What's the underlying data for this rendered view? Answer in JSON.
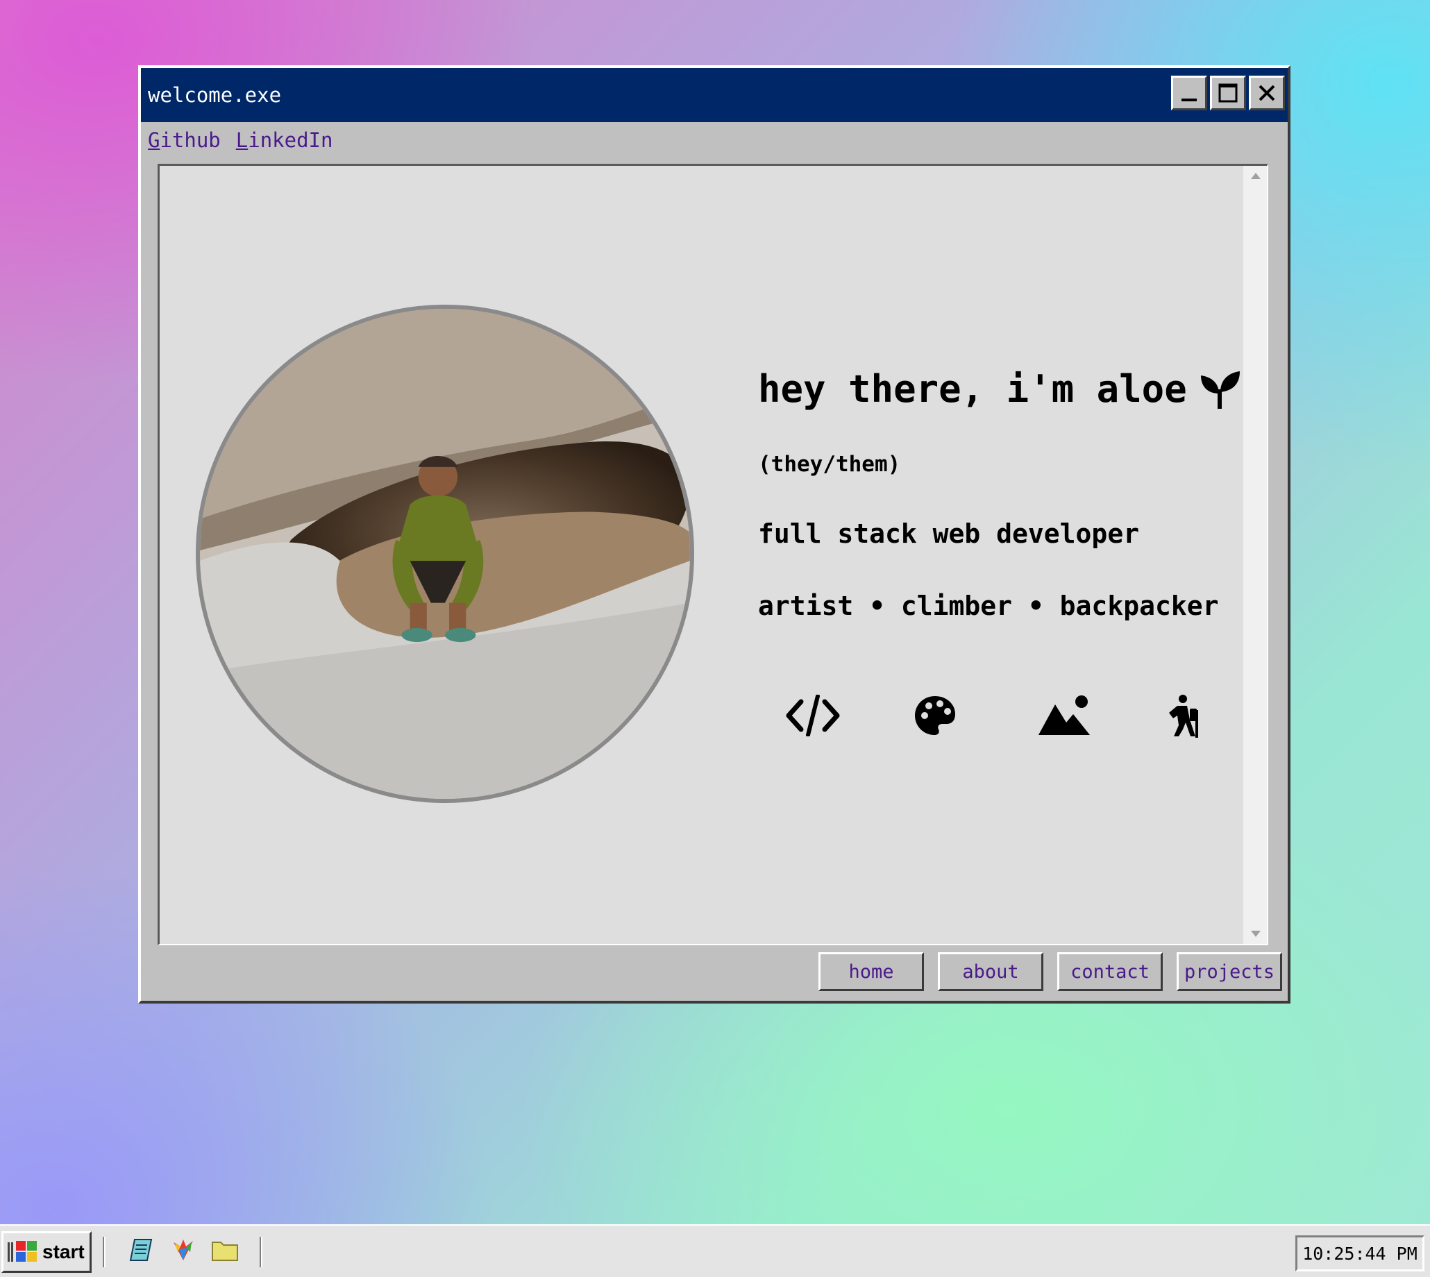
{
  "window": {
    "title": "welcome.exe",
    "controls": {
      "minimize": "minimize-icon",
      "maximize": "maximize-icon",
      "close": "close-icon"
    }
  },
  "menu": {
    "links": [
      {
        "accel": "G",
        "rest": "ithub"
      },
      {
        "accel": "L",
        "rest": "inkedIn"
      }
    ]
  },
  "intro": {
    "title": "hey there, i'm aloe",
    "title_icon": "seedling-icon",
    "pronouns": "(they/them)",
    "role": "full stack web developer",
    "hobbies": "artist • climber • backpacker",
    "hobby_icons": [
      "code-icon",
      "palette-icon",
      "mountain-icon",
      "hiker-icon"
    ]
  },
  "nav": {
    "buttons": [
      "home",
      "about",
      "contact",
      "projects"
    ]
  },
  "taskbar": {
    "start_label": "start",
    "quick_launch": [
      "notepad-icon",
      "paint-icon",
      "folder-icon"
    ],
    "clock": "10:25:44 PM"
  },
  "colors": {
    "titlebar": "#002868",
    "link": "#4a1a8a",
    "window_face": "#c0c0c0",
    "content_bg": "#dedede"
  }
}
